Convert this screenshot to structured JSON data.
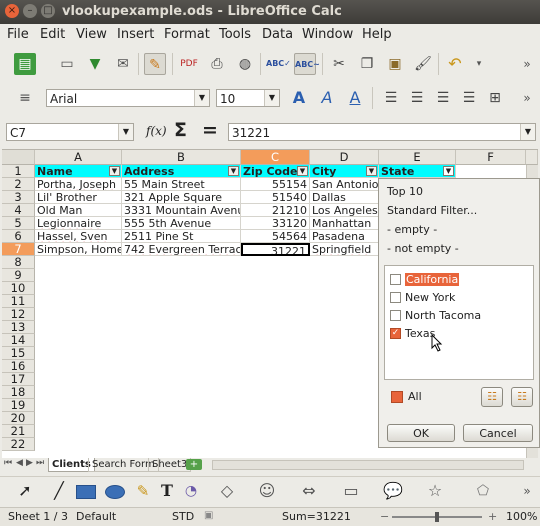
{
  "window": {
    "title": "vlookupexample.ods - LibreOffice Calc",
    "close": "×",
    "min": "–",
    "max": "□"
  },
  "menu": [
    "File",
    "Edit",
    "View",
    "Insert",
    "Format",
    "Tools",
    "Data",
    "Window",
    "Help"
  ],
  "format_bar": {
    "font_name": "Arial",
    "font_size": "10"
  },
  "formula_bar": {
    "cell_ref": "C7",
    "fx": "f(x)",
    "sum": "Σ",
    "equals": "=",
    "value": "31221"
  },
  "columns": [
    "A",
    "B",
    "C",
    "D",
    "E",
    "F"
  ],
  "rows": [
    "1",
    "2",
    "3",
    "4",
    "5",
    "6",
    "7",
    "8",
    "9",
    "10",
    "11",
    "12",
    "13",
    "14",
    "15",
    "16",
    "17",
    "18",
    "19",
    "20",
    "21",
    "22"
  ],
  "table": {
    "headers": [
      "Name",
      "Address",
      "Zip Code",
      "City",
      "State"
    ],
    "rows": [
      [
        "Portha, Joseph",
        "55 Main Street",
        "55154",
        "San Antonio"
      ],
      [
        "Lil' Brother",
        "321 Apple Square",
        "51540",
        "Dallas"
      ],
      [
        "Old Man",
        "3331 Mountain Avenue",
        "21210",
        "Los Angeles"
      ],
      [
        "Legionnaire",
        "555 5th Avenue",
        "33120",
        "Manhattan"
      ],
      [
        "Hassel, Sven",
        "2511 Pine St",
        "54564",
        "Pasadena"
      ],
      [
        "Simpson, Homer",
        "742 Evergreen Terrace",
        "31221",
        "Springfield"
      ]
    ]
  },
  "autofilter": {
    "menu": [
      "Top 10",
      "Standard Filter...",
      "- empty -",
      "- not empty -"
    ],
    "values": [
      {
        "label": "California",
        "checked": false
      },
      {
        "label": "New York",
        "checked": false
      },
      {
        "label": "North Tacoma",
        "checked": false
      },
      {
        "label": "Texas",
        "checked": true
      }
    ],
    "all_label": "All",
    "ok": "OK",
    "cancel": "Cancel"
  },
  "sheets": [
    "Clients",
    "Search Form",
    "Sheet3"
  ],
  "status": {
    "sheet": "Sheet 1 / 3",
    "style": "Default",
    "mode": "STD",
    "sum": "Sum=31221",
    "zoom": "100%",
    "zoom_level": 0.5
  },
  "colors": {
    "header_fill": "#00fcff",
    "selected_col": "#f39c5b",
    "accent": "#e8643a"
  }
}
